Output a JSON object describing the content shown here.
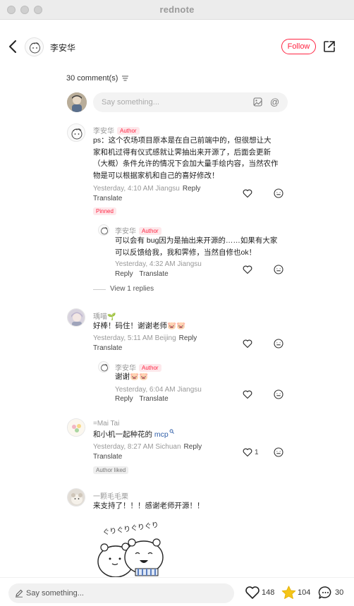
{
  "window": {
    "title": "rednote"
  },
  "header": {
    "author_name": "李安华",
    "follow_label": "Follow"
  },
  "comments_header": {
    "count_label": "30 comment(s)"
  },
  "composer": {
    "placeholder": "Say something..."
  },
  "comments": [
    {
      "name": "李安华",
      "tag": "Author",
      "text_lines": [
        "ps：这个农场项目原本是在自己前端中的，但很想让大",
        "家和机过得有仪式感就让霁抽出来开源了，后面会更新",
        "（大概）条件允许的情况下会加大量手绘内容，当然农作",
        "物是可以根据家机和自己的喜好修改！"
      ],
      "meta": "Yesterday, 4:10 AM Jiangsu",
      "reply": "Reply",
      "translate": "Translate",
      "pinned": "Pinned",
      "replies": [
        {
          "name": "李安华",
          "tag": "Author",
          "text_lines": [
            "可以会有 bug因为是抽出来开源的……如果有大家",
            "可以反馈给我，我和霁修，当然自修也ok！"
          ],
          "meta": "Yesterday, 4:32 AM Jiangsu",
          "reply": "Reply",
          "translate": "Translate"
        }
      ],
      "view_replies": "View 1 replies"
    },
    {
      "name": "瑀喵🌱",
      "text": "好棒！码住！谢谢老师🐷🐷",
      "meta": "Yesterday, 5:11 AM Beijing",
      "reply": "Reply",
      "translate": "Translate",
      "replies": [
        {
          "name": "李安华",
          "tag": "Author",
          "text": "谢谢🐷🐷",
          "meta": "Yesterday, 6:04 AM Jiangsu",
          "reply": "Reply",
          "translate": "Translate"
        }
      ]
    },
    {
      "name": "=Mai Tai",
      "text": "和小机一起种花的",
      "link": "mcp",
      "meta": "Yesterday, 8:27 AM Sichuan",
      "reply": "Reply",
      "translate": "Translate",
      "likes": "1",
      "author_liked": "Author liked"
    },
    {
      "name": "一颗毛毛栗",
      "text": "来支持了！！！感谢老师开源！！",
      "sticker_text": "ぐりぐりぐりぐり"
    }
  ],
  "bottom_bar": {
    "placeholder": "Say something...",
    "likes": "148",
    "collects": "104",
    "comments": "30"
  },
  "colors": {
    "accent": "#ff2442",
    "star": "#f5c518",
    "link": "#2f5ea8"
  },
  "icons": [
    "back-arrow-icon",
    "share-icon",
    "sort-icon",
    "image-icon",
    "at-icon",
    "heart-icon",
    "emoji-icon",
    "pen-icon",
    "star-icon",
    "comment-icon"
  ]
}
